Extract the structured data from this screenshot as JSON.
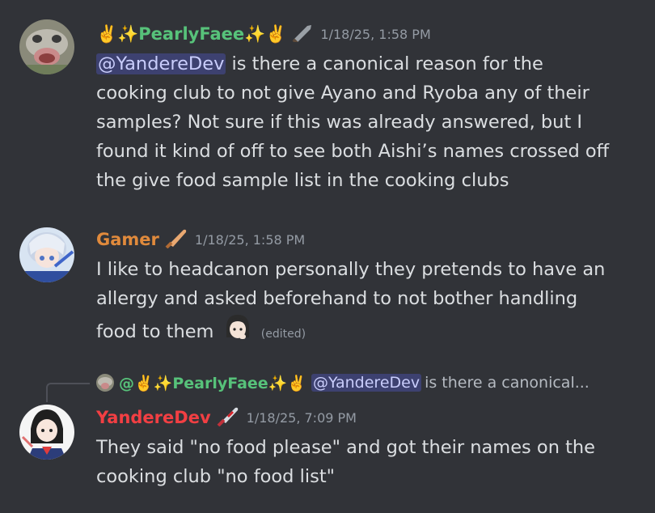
{
  "messages": [
    {
      "username": "✌️✨PearlyFaee✨✌️",
      "username_color": "#57c27a",
      "badge_icon": "sword-icon",
      "timestamp": "1/18/25, 1:58 PM",
      "mention": "@YandereDev",
      "text_after_mention": " is there a canonical reason for the cooking club to not give Ayano and Ryoba any of their samples? Not sure if this was already answered, but I found it kind of off to see both Aishi’s names crossed off the give food sample list in the cooking clubs"
    },
    {
      "username": "Gamer",
      "username_color": "#e08a3c",
      "badge_icon": "knife-icon",
      "timestamp": "1/18/25, 1:58 PM",
      "text": "I like to headcanon personally they pretends to have an allergy and asked beforehand to not bother handling food to them",
      "emoji": "thinking-girl-emoji",
      "edited_label": "(edited)"
    },
    {
      "reply": {
        "username": "@✌️✨PearlyFaee✨✌️",
        "mention": "@YandereDev",
        "text": "is there a canonical..."
      },
      "username": "YandereDev",
      "username_color": "#f23f43",
      "badge_icon": "bloody-knife-icon",
      "timestamp": "1/18/25, 7:09 PM",
      "text": "They said \"no food please\" and got their names on the cooking club \"no food list\""
    }
  ]
}
